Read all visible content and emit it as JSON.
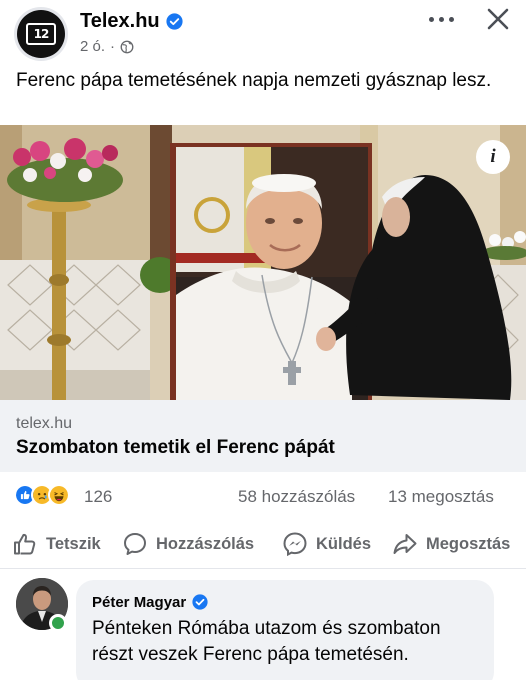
{
  "post": {
    "page_name": "Telex.hu",
    "logo_text": "12",
    "time": "2 ó.",
    "separator": "·",
    "text": "Ferenc pápa temetésének napja nemzeti gyásznap lesz."
  },
  "link": {
    "domain": "telex.hu",
    "title": "Szombaton temetik el Ferenc pápát"
  },
  "stats": {
    "reactions_count": "126",
    "comments": "58 hozzászólás",
    "shares": "13 megosztás"
  },
  "actions": {
    "like": "Tetszik",
    "comment": "Hozzászólás",
    "send": "Küldés",
    "share": "Megosztás"
  },
  "comment": {
    "author": "Péter Magyar",
    "text": "Pénteken Rómába utazom és szombaton részt veszek Ferenc pápa temetésén."
  },
  "icons": {
    "verified": "verified-badge-icon",
    "globe": "globe-icon",
    "more": "more-dots-icon",
    "close": "close-icon",
    "info": "info-icon",
    "like": "thumbs-up-icon",
    "comment": "comment-bubble-icon",
    "send": "messenger-icon",
    "share": "share-arrow-icon",
    "reactions": [
      "like-reaction-icon",
      "sad-reaction-icon",
      "haha-reaction-icon"
    ]
  },
  "colors": {
    "brand_blue": "#1877f2",
    "text_secondary": "#65676b",
    "link_bg": "#f0f2f5",
    "online_green": "#31a24c"
  }
}
